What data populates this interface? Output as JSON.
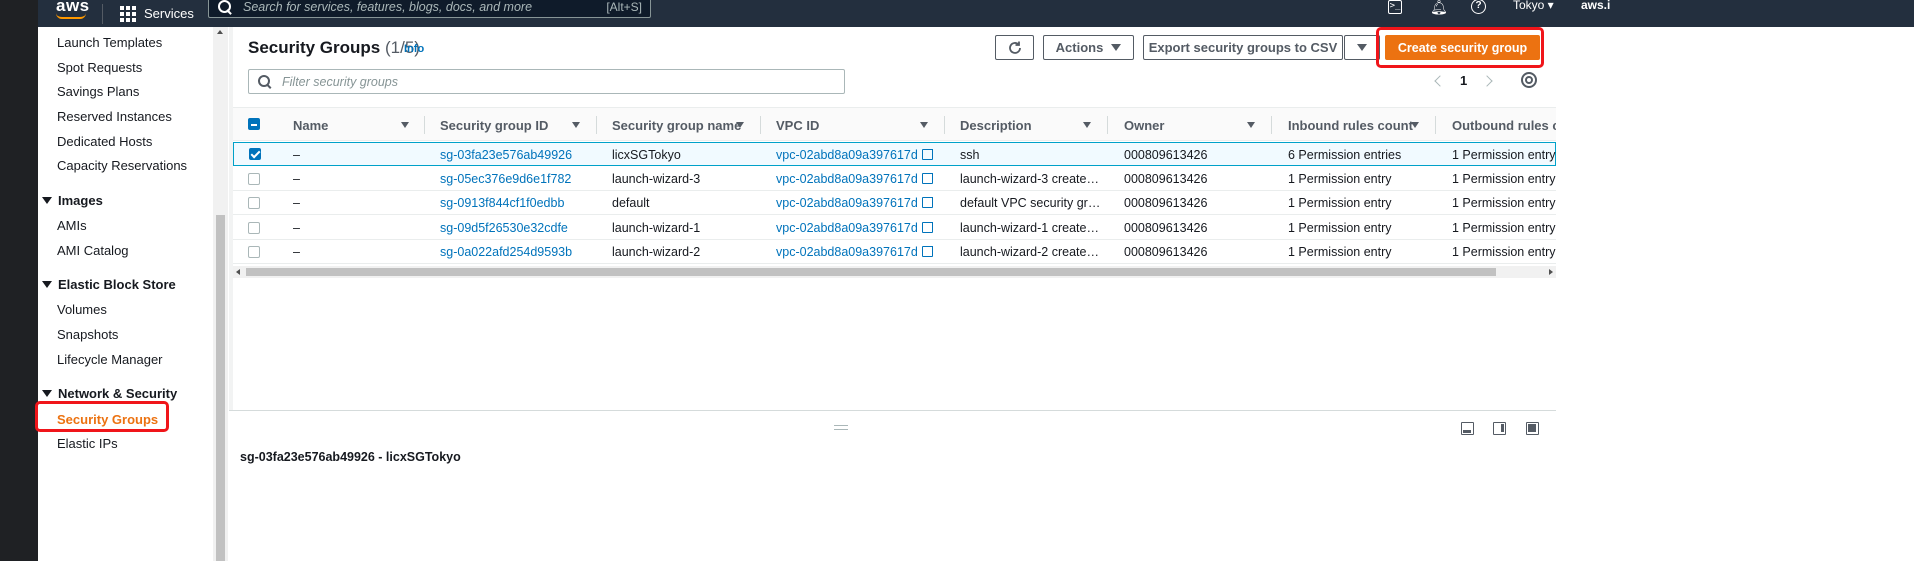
{
  "topnav": {
    "logo": "aws",
    "services": "Services",
    "search_placeholder": "Search for services, features, blogs, docs, and more",
    "search_shortcut": "[Alt+S]",
    "region": "Tokyo ▾",
    "account": "aws.i"
  },
  "sidebar": {
    "items_top": [
      "Launch Templates",
      "Spot Requests",
      "Savings Plans",
      "Reserved Instances",
      "Dedicated Hosts",
      "Capacity Reservations"
    ],
    "images": {
      "title": "Images",
      "items": [
        "AMIs",
        "AMI Catalog"
      ]
    },
    "ebs": {
      "title": "Elastic Block Store",
      "items": [
        "Volumes",
        "Snapshots",
        "Lifecycle Manager"
      ]
    },
    "network": {
      "title": "Network & Security",
      "items": [
        "Security Groups",
        "Elastic IPs"
      ]
    }
  },
  "main": {
    "title": "Security Groups",
    "count": "(1/5)",
    "info": "Info",
    "actions_label": "Actions",
    "export_label": "Export security groups to CSV",
    "create_label": "Create security group",
    "filter_placeholder": "Filter security groups",
    "page": "1"
  },
  "table": {
    "columns": [
      "Name",
      "Security group ID",
      "Security group name",
      "VPC ID",
      "Description",
      "Owner",
      "Inbound rules count",
      "Outbound rules co"
    ],
    "rows": [
      {
        "selected": true,
        "name": "–",
        "id": "sg-03fa23e576ab49926",
        "sgname": "licxSGTokyo",
        "vpc": "vpc-02abd8a09a397617d",
        "desc": "ssh",
        "owner": "000809613426",
        "inbound": "6 Permission entries",
        "outbound": "1 Permission entry"
      },
      {
        "selected": false,
        "name": "–",
        "id": "sg-05ec376e9d6e1f782",
        "sgname": "launch-wizard-3",
        "vpc": "vpc-02abd8a09a397617d",
        "desc": "launch-wizard-3 create…",
        "owner": "000809613426",
        "inbound": "1 Permission entry",
        "outbound": "1 Permission entry"
      },
      {
        "selected": false,
        "name": "–",
        "id": "sg-0913f844cf1f0edbb",
        "sgname": "default",
        "vpc": "vpc-02abd8a09a397617d",
        "desc": "default VPC security gr…",
        "owner": "000809613426",
        "inbound": "1 Permission entry",
        "outbound": "1 Permission entry"
      },
      {
        "selected": false,
        "name": "–",
        "id": "sg-09d5f26530e32cdfe",
        "sgname": "launch-wizard-1",
        "vpc": "vpc-02abd8a09a397617d",
        "desc": "launch-wizard-1 create…",
        "owner": "000809613426",
        "inbound": "1 Permission entry",
        "outbound": "1 Permission entry"
      },
      {
        "selected": false,
        "name": "–",
        "id": "sg-0a022afd254d9593b",
        "sgname": "launch-wizard-2",
        "vpc": "vpc-02abd8a09a397617d",
        "desc": "launch-wizard-2 create…",
        "owner": "000809613426",
        "inbound": "1 Permission entry",
        "outbound": "1 Permission entry"
      }
    ]
  },
  "split": {
    "title": "sg-03fa23e576ab49926 - licxSGTokyo"
  },
  "colors": {
    "accent": "#ec7211",
    "link": "#0073bb",
    "highlight": "#f0151a",
    "nav_bg": "#232f3e"
  }
}
